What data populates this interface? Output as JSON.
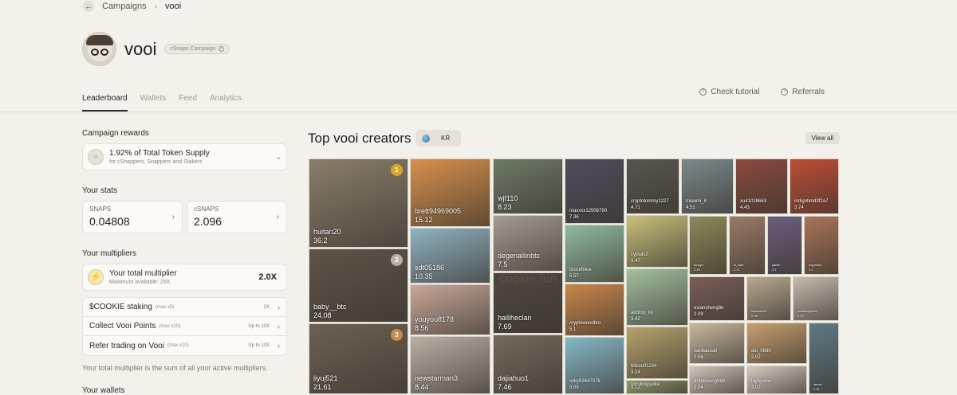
{
  "breadcrumb": {
    "back_icon": "arrow-left-icon",
    "parent": "Campaigns",
    "current": "vooi"
  },
  "header": {
    "title": "vooi",
    "badge": "cSnaps Campaign"
  },
  "tabs": [
    "Leaderboard",
    "Wallets",
    "Feed",
    "Analytics"
  ],
  "links": {
    "tutorial": "Check tutorial",
    "referrals": "Referrals"
  },
  "rewards": {
    "section": "Campaign rewards",
    "main": "1.92% of Total Token Supply",
    "sub": "for cSnappers, Snappers and Stakers"
  },
  "stats": {
    "section": "Your stats",
    "snaps_label": "SNAPS",
    "snaps_value": "0.04808",
    "csnaps_label": "cSNAPS",
    "csnaps_value": "2.096"
  },
  "multipliers": {
    "section": "Your multipliers",
    "total_label": "Your total multiplier",
    "total_sub": "Maximum available: 25X",
    "total_value": "2.0X",
    "rows": [
      {
        "label": "$COOKIE staking",
        "tag": "(max x5)",
        "value": "2X"
      },
      {
        "label": "Collect Vooi Points",
        "tag": "(max x10)",
        "value": "Up to 10X"
      },
      {
        "label": "Refer trading on Vooi",
        "tag": "(max x10)",
        "value": "Up to 10X"
      }
    ],
    "note": "Your total multiplier is the sum of all your active multipliers."
  },
  "wallets_section": "Your wallets",
  "creators": {
    "title": "Top vooi creators",
    "lang": "KR",
    "view_all": "View all",
    "watermark": "cookie.fun",
    "tiles": [
      {
        "name": "huitan20",
        "score": "36.2",
        "rank": "1",
        "color": "#8a7d6a",
        "rank_color": "#d9a62c"
      },
      {
        "name": "baby__btc",
        "score": "24.08",
        "rank": "2",
        "color": "#5e5448",
        "rank_color": "#b8b2a8"
      },
      {
        "name": "liyuj521",
        "score": "21.61",
        "rank": "3",
        "color": "#6c6253",
        "rank_color": "#c98a4a"
      },
      {
        "name": "brett94969005",
        "score": "15.12",
        "color": "#d8904a"
      },
      {
        "name": "sdt05186",
        "score": "10.35",
        "color": "#8fb2c2"
      },
      {
        "name": "youyou8178",
        "score": "8.56",
        "color": "#c8a89a"
      },
      {
        "name": "newstarman3",
        "score": "8.44",
        "color": "#b8b0a4"
      },
      {
        "name": "wjf110",
        "score": "8.23",
        "color": "#6d7a66"
      },
      {
        "name": "degenallinbtc",
        "score": "7.5",
        "color": "#a39c90"
      },
      {
        "name": "hailiheclan",
        "score": "7.69",
        "color": "#4d4840"
      },
      {
        "name": "dajiahuo1",
        "score": "7.46",
        "color": "#736a5c"
      },
      {
        "name": "maxxxx12506790",
        "score": "7.36",
        "color": "#524b5e"
      },
      {
        "name": "brucelblue",
        "score": "5.57",
        "color": "#8fbaa0"
      },
      {
        "name": "cryptowoodbro",
        "score": "5.1",
        "color": "#c9864a"
      },
      {
        "name": "scky92447078",
        "score": "5.09",
        "color": "#84b8c8"
      },
      {
        "name": "cryptotommy1227",
        "score": "4.71",
        "color": "#5a5550"
      },
      {
        "name": "cylouis2",
        "score": "3.47",
        "color": "#c9c07a"
      },
      {
        "name": "airdrop_lin",
        "score": "3.42",
        "color": "#a3c0a0"
      },
      {
        "name": "bitcoolf1234",
        "score": "3.24",
        "color": "#b6a26d"
      },
      {
        "name": "0xrollingspike",
        "score": "3.12",
        "color": "#8e9a6a"
      },
      {
        "name": "miaomi_8",
        "score": "4.51",
        "color": "#7a8a8e"
      },
      {
        "name": "xu41028663",
        "score": "4.43",
        "color": "#8a4a3e"
      },
      {
        "name": "indigotimd3f2a7",
        "score": "3.74",
        "color": "#c04c34"
      },
      {
        "name": "tonyyu",
        "score": "3.45",
        "color": "#8a8a5a"
      },
      {
        "name": "w_clan",
        "score": "3.11",
        "color": "#9a7a68"
      },
      {
        "name": "yanlin",
        "score": "3.1",
        "color": "#6a5e7e"
      },
      {
        "name": "cryptofun",
        "score": "3.1",
        "color": "#a8745a"
      },
      {
        "name": "exiansheng8e",
        "score": "2.09",
        "color": "#7a5e58"
      },
      {
        "name": "laobloek20",
        "score": "2.04",
        "color": "#b8a890"
      },
      {
        "name": "missfang1802",
        "score": "2.02",
        "color": "#c4bcae"
      },
      {
        "name": "sanbaiusdt",
        "score": "2.06",
        "color": "#c8b8a0"
      },
      {
        "name": "alu_0880",
        "score": "2.02",
        "color": "#c8a070"
      },
      {
        "name": "dnfpkwang888",
        "score": "2.04",
        "color": "#cfc6b8"
      },
      {
        "name": "laybyeloo",
        "score": "2.02",
        "color": "#d4ccbe"
      },
      {
        "name": "lancet",
        "score": "2.01",
        "color": "#5e7a84"
      }
    ]
  }
}
